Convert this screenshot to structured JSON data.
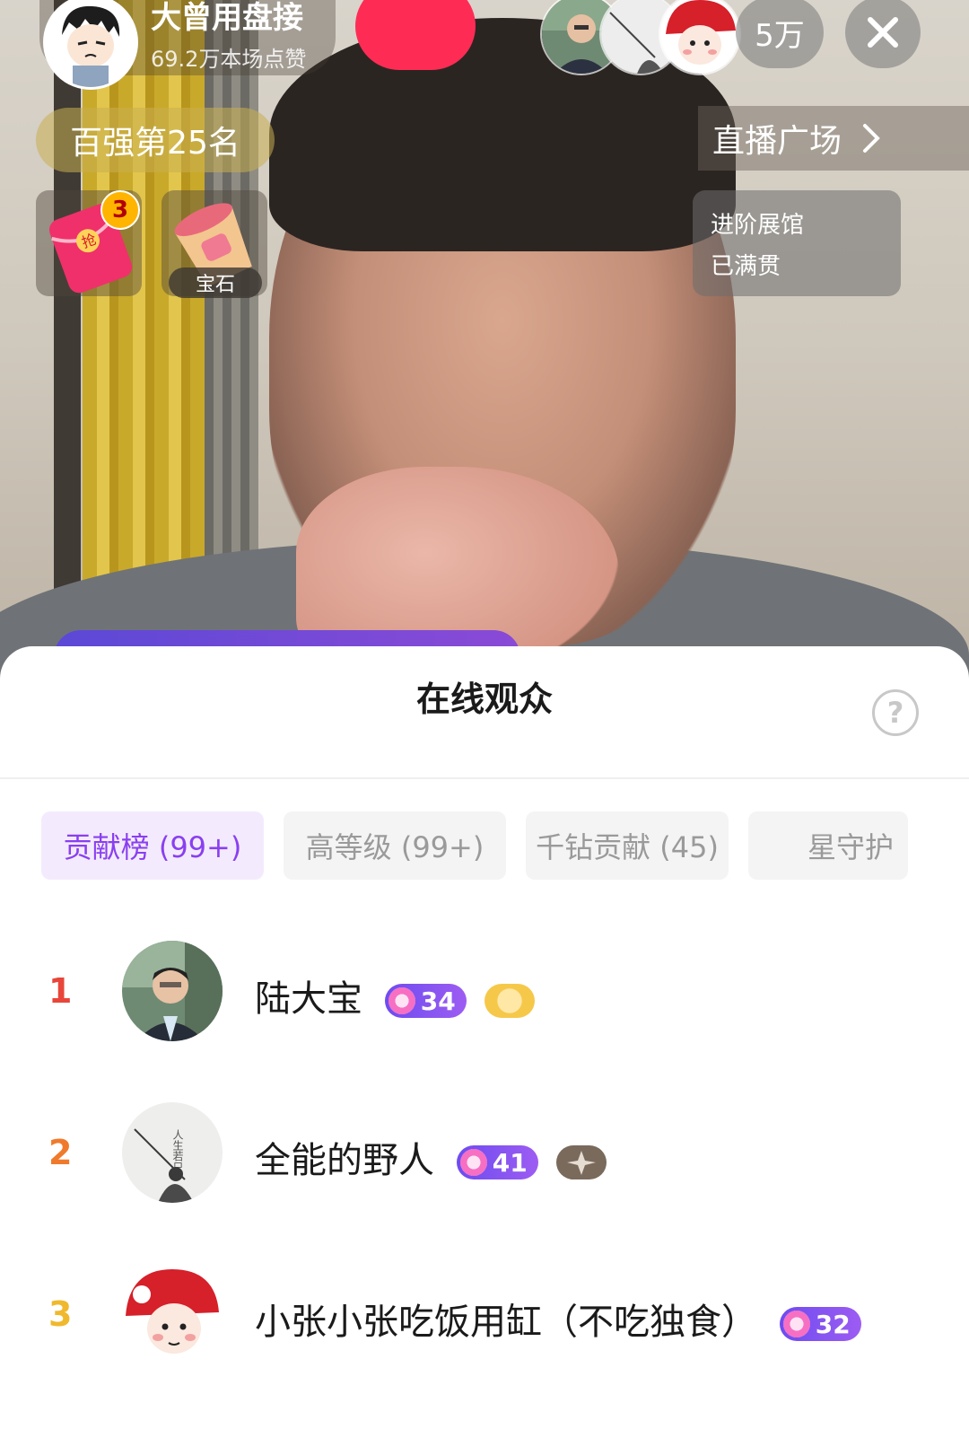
{
  "stream": {
    "host_name": "大曾用盘接",
    "likes": "69.2万本场点赞",
    "viewer_count": "5万",
    "rank_text": "百强第25名",
    "plaza_text": "直播广场",
    "redpacket_count": "3",
    "gem_label": "宝石",
    "hall": {
      "line1": "进阶展馆",
      "line2": "已满贯"
    }
  },
  "sheet": {
    "title": "在线观众",
    "tabs": [
      {
        "label": "贡献榜 (99+)",
        "active": true
      },
      {
        "label": "高等级 (99+)",
        "active": false
      },
      {
        "label": "千钻贡献 (45)",
        "active": false
      },
      {
        "label": "星守护",
        "active": false
      }
    ],
    "rows": [
      {
        "rank": "1",
        "name": "陆大宝",
        "level": "34",
        "rank_color": "#e8463a",
        "medal": "gold-coin"
      },
      {
        "rank": "2",
        "name": "全能的野人",
        "level": "41",
        "rank_color": "#f07a2c",
        "medal": "star-badge"
      },
      {
        "rank": "3",
        "name": "小张小张吃饭用缸（不吃独食）",
        "level": "32",
        "rank_color": "#f0b82c",
        "medal": ""
      }
    ]
  },
  "colors": {
    "accent": "#fe2c55",
    "tab_active": "#8a3ff0",
    "level_badge": "#7a52f0"
  }
}
